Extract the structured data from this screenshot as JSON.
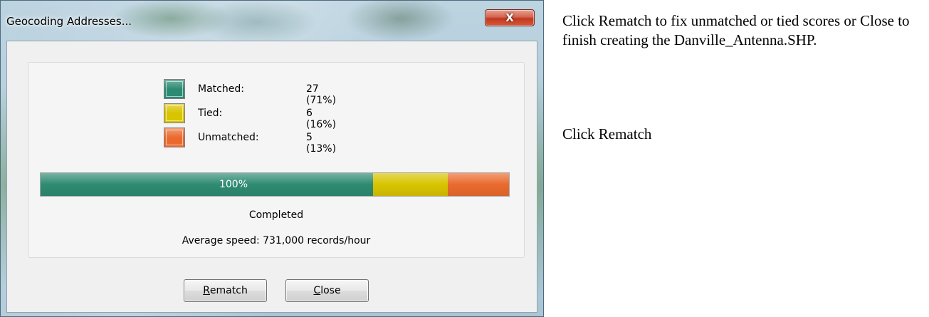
{
  "window": {
    "title": "Geocoding Addresses...",
    "close_glyph": "X"
  },
  "legend": [
    {
      "label": "Matched:",
      "value": "27 (71%)",
      "color": "#2e8b73"
    },
    {
      "label": "Tied:",
      "value": "6 (16%)",
      "color": "#d8c400"
    },
    {
      "label": "Unmatched:",
      "value": "5 (13%)",
      "color": "#ea6a2e"
    }
  ],
  "progress": {
    "text": "100%",
    "percent_complete": 100,
    "segments_percent": [
      71,
      16,
      13
    ]
  },
  "status_text": "Completed",
  "speed_text": "Average speed: 731,000 records/hour",
  "buttons": {
    "rematch": {
      "mnemonic": "R",
      "rest": "ematch"
    },
    "close": {
      "mnemonic": "C",
      "rest": "lose"
    }
  },
  "instructions": {
    "paragraph": "Click Rematch to fix unmatched or tied scores or Close to finish creating the Danville_Antenna.SHP.",
    "step": "Click Rematch"
  }
}
